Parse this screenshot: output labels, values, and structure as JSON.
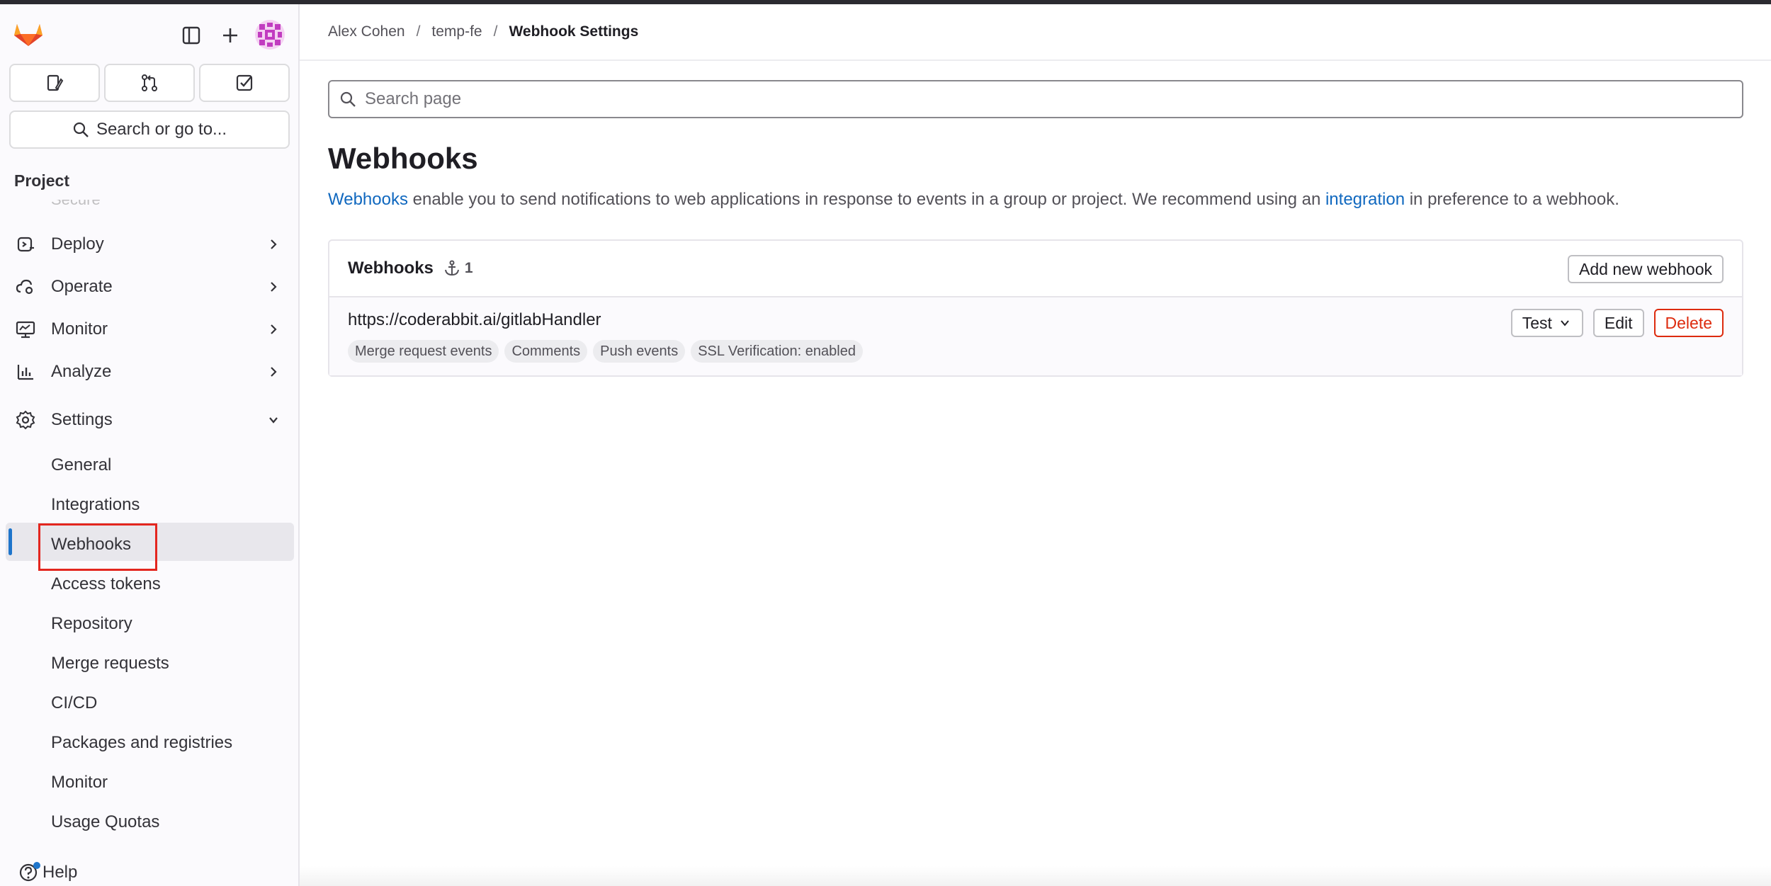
{
  "sidebar": {
    "quick_actions": [
      "issues-icon",
      "merge-requests-icon",
      "todo-icon"
    ],
    "search_label": "Search or go to...",
    "section_title": "Project",
    "faded_item": "Secure",
    "nav": [
      {
        "label": "Deploy",
        "icon": "rocket-icon"
      },
      {
        "label": "Operate",
        "icon": "cloud-gear-icon"
      },
      {
        "label": "Monitor",
        "icon": "monitor-icon"
      },
      {
        "label": "Analyze",
        "icon": "chart-icon"
      },
      {
        "label": "Settings",
        "icon": "gear-icon"
      }
    ],
    "settings_items": [
      "General",
      "Integrations",
      "Webhooks",
      "Access tokens",
      "Repository",
      "Merge requests",
      "CI/CD",
      "Packages and registries",
      "Monitor",
      "Usage Quotas"
    ],
    "active_item": "Webhooks",
    "help_label": "Help"
  },
  "breadcrumb": {
    "items": [
      "Alex Cohen",
      "temp-fe"
    ],
    "current": "Webhook Settings"
  },
  "search": {
    "placeholder": "Search page"
  },
  "page": {
    "title": "Webhooks",
    "desc_link1": "Webhooks",
    "desc_mid": "enable you to send notifications to web applications in response to events in a group or project. We recommend using an",
    "desc_link2": "integration",
    "desc_end": "in preference to a webhook."
  },
  "card": {
    "title": "Webhooks",
    "count": "1",
    "add_label": "Add new webhook",
    "hooks": [
      {
        "url": "https://coderabbit.ai/gitlabHandler",
        "badges": [
          "Merge request events",
          "Comments",
          "Push events",
          "SSL Verification: enabled"
        ],
        "test_label": "Test",
        "edit_label": "Edit",
        "delete_label": "Delete"
      }
    ]
  },
  "colors": {
    "accent": "#1f75cb",
    "link": "#1068bf",
    "danger": "#dd2b0e",
    "highlight": "#e3261f"
  }
}
